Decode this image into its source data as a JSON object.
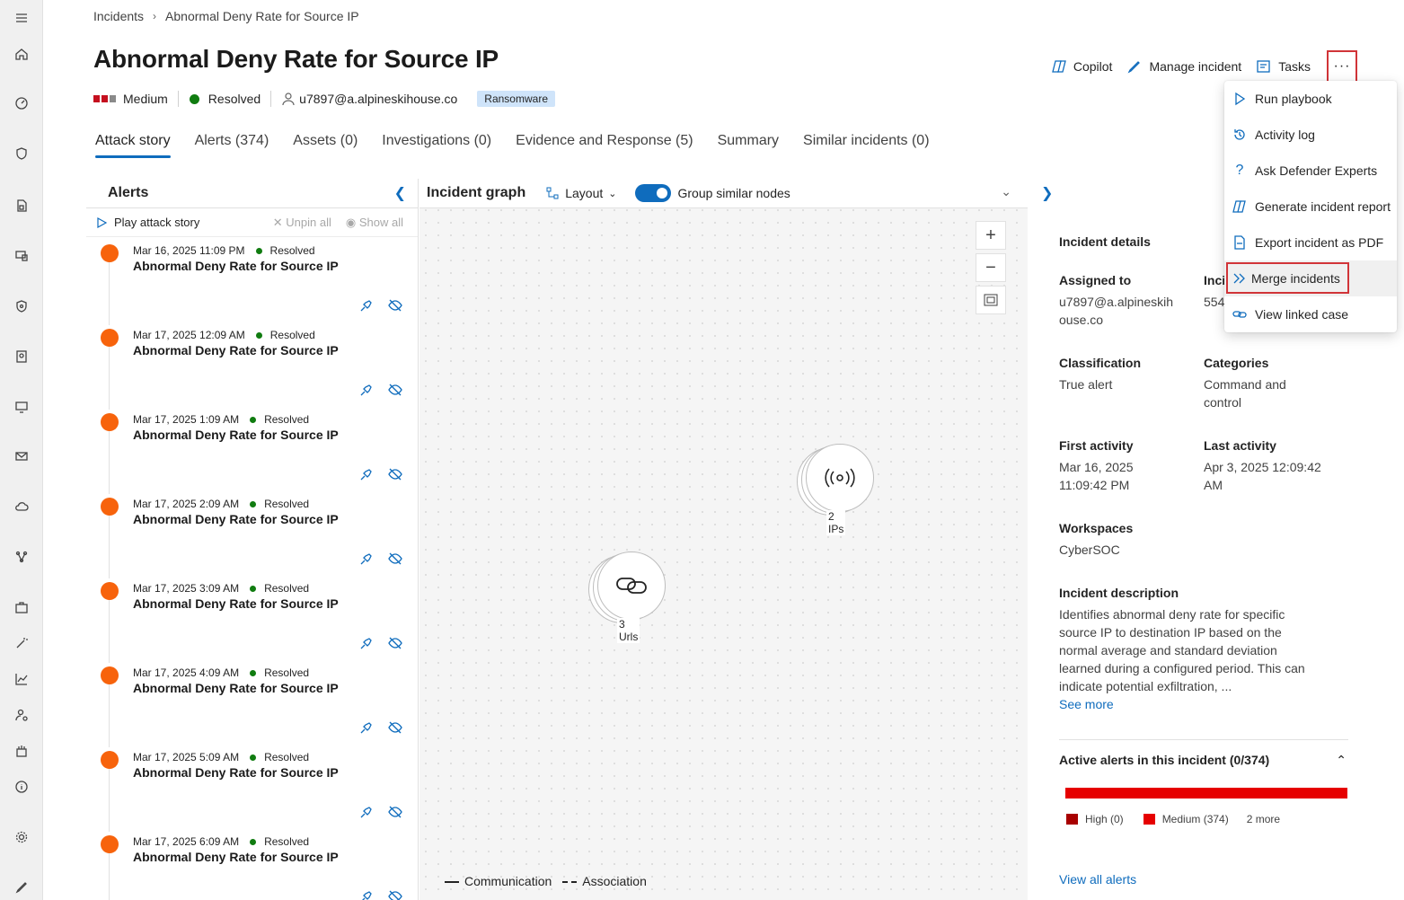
{
  "breadcrumb": {
    "root": "Incidents",
    "current": "Abnormal Deny Rate for Source IP"
  },
  "page_title": "Abnormal Deny Rate for Source IP",
  "meta": {
    "severity": "Medium",
    "status": "Resolved",
    "user": "u7897@a.alpineskihouse.co",
    "tag": "Ransomware",
    "colors": {
      "severity_fill": "#c50f1f",
      "severity_empty": "#8a8a8a",
      "resolved": "#107c10"
    }
  },
  "actions": {
    "copilot": "Copilot",
    "manage": "Manage incident",
    "tasks": "Tasks",
    "more": "···"
  },
  "tabs": [
    {
      "label": "Attack story"
    },
    {
      "label": "Alerts (374)"
    },
    {
      "label": "Assets (0)"
    },
    {
      "label": "Investigations (0)"
    },
    {
      "label": "Evidence and Response (5)"
    },
    {
      "label": "Summary"
    },
    {
      "label": "Similar incidents (0)"
    }
  ],
  "alerts_panel": {
    "title": "Alerts",
    "play": "Play attack story",
    "unpin_all": "Unpin all",
    "show_all": "Show all",
    "items": [
      {
        "time": "Mar 16, 2025 11:09 PM",
        "status": "Resolved",
        "name": "Abnormal Deny Rate for Source IP"
      },
      {
        "time": "Mar 17, 2025 12:09 AM",
        "status": "Resolved",
        "name": "Abnormal Deny Rate for Source IP"
      },
      {
        "time": "Mar 17, 2025 1:09 AM",
        "status": "Resolved",
        "name": "Abnormal Deny Rate for Source IP"
      },
      {
        "time": "Mar 17, 2025 2:09 AM",
        "status": "Resolved",
        "name": "Abnormal Deny Rate for Source IP"
      },
      {
        "time": "Mar 17, 2025 3:09 AM",
        "status": "Resolved",
        "name": "Abnormal Deny Rate for Source IP"
      },
      {
        "time": "Mar 17, 2025 4:09 AM",
        "status": "Resolved",
        "name": "Abnormal Deny Rate for Source IP"
      },
      {
        "time": "Mar 17, 2025 5:09 AM",
        "status": "Resolved",
        "name": "Abnormal Deny Rate for Source IP"
      },
      {
        "time": "Mar 17, 2025 6:09 AM",
        "status": "Resolved",
        "name": "Abnormal Deny Rate for Source IP"
      }
    ]
  },
  "graph": {
    "title": "Incident graph",
    "layout": "Layout",
    "group_label": "Group similar nodes",
    "nodes": {
      "ips": "2 IPs",
      "urls": "3 Urls"
    },
    "legend": {
      "communication": "Communication",
      "association": "Association"
    }
  },
  "details": {
    "heading": "Incident details",
    "assigned_label": "Assigned to",
    "assigned_value": "u7897@a.alpineskih ouse.co",
    "incident_label_partial": "Inci",
    "incident_value_partial": "554",
    "classification_label": "Classification",
    "classification_value": "True alert",
    "categories_label": "Categories",
    "categories_value": "Command and control",
    "first_label": "First activity",
    "first_value": "Mar 16, 2025 11:09:42 PM",
    "last_label": "Last activity",
    "last_value": "Apr 3, 2025 12:09:42 AM",
    "workspaces_label": "Workspaces",
    "workspaces_value": "CyberSOC",
    "description_label": "Incident description",
    "description_value": "Identifies abnormal deny rate for specific source IP to destination IP based on the normal average and standard deviation learned during a configured period. This can indicate potential exfiltration, ...",
    "see_more": "See more",
    "active_alerts_title": "Active alerts in this incident (0/374)",
    "sev_high": "High (0)",
    "sev_medium": "Medium (374)",
    "sev_more": "2 more",
    "view_all": "View all alerts"
  },
  "menu": {
    "items": [
      {
        "label": "Run playbook",
        "icon": "play-icon"
      },
      {
        "label": "Activity log",
        "icon": "history-icon"
      },
      {
        "label": "Ask Defender Experts",
        "icon": "question-icon"
      },
      {
        "label": "Generate incident report",
        "icon": "copilot-icon"
      },
      {
        "label": "Export incident as PDF",
        "icon": "pdf-icon"
      },
      {
        "label": "Merge incidents",
        "icon": "merge-icon"
      },
      {
        "label": "View linked case",
        "icon": "link-icon"
      }
    ]
  }
}
